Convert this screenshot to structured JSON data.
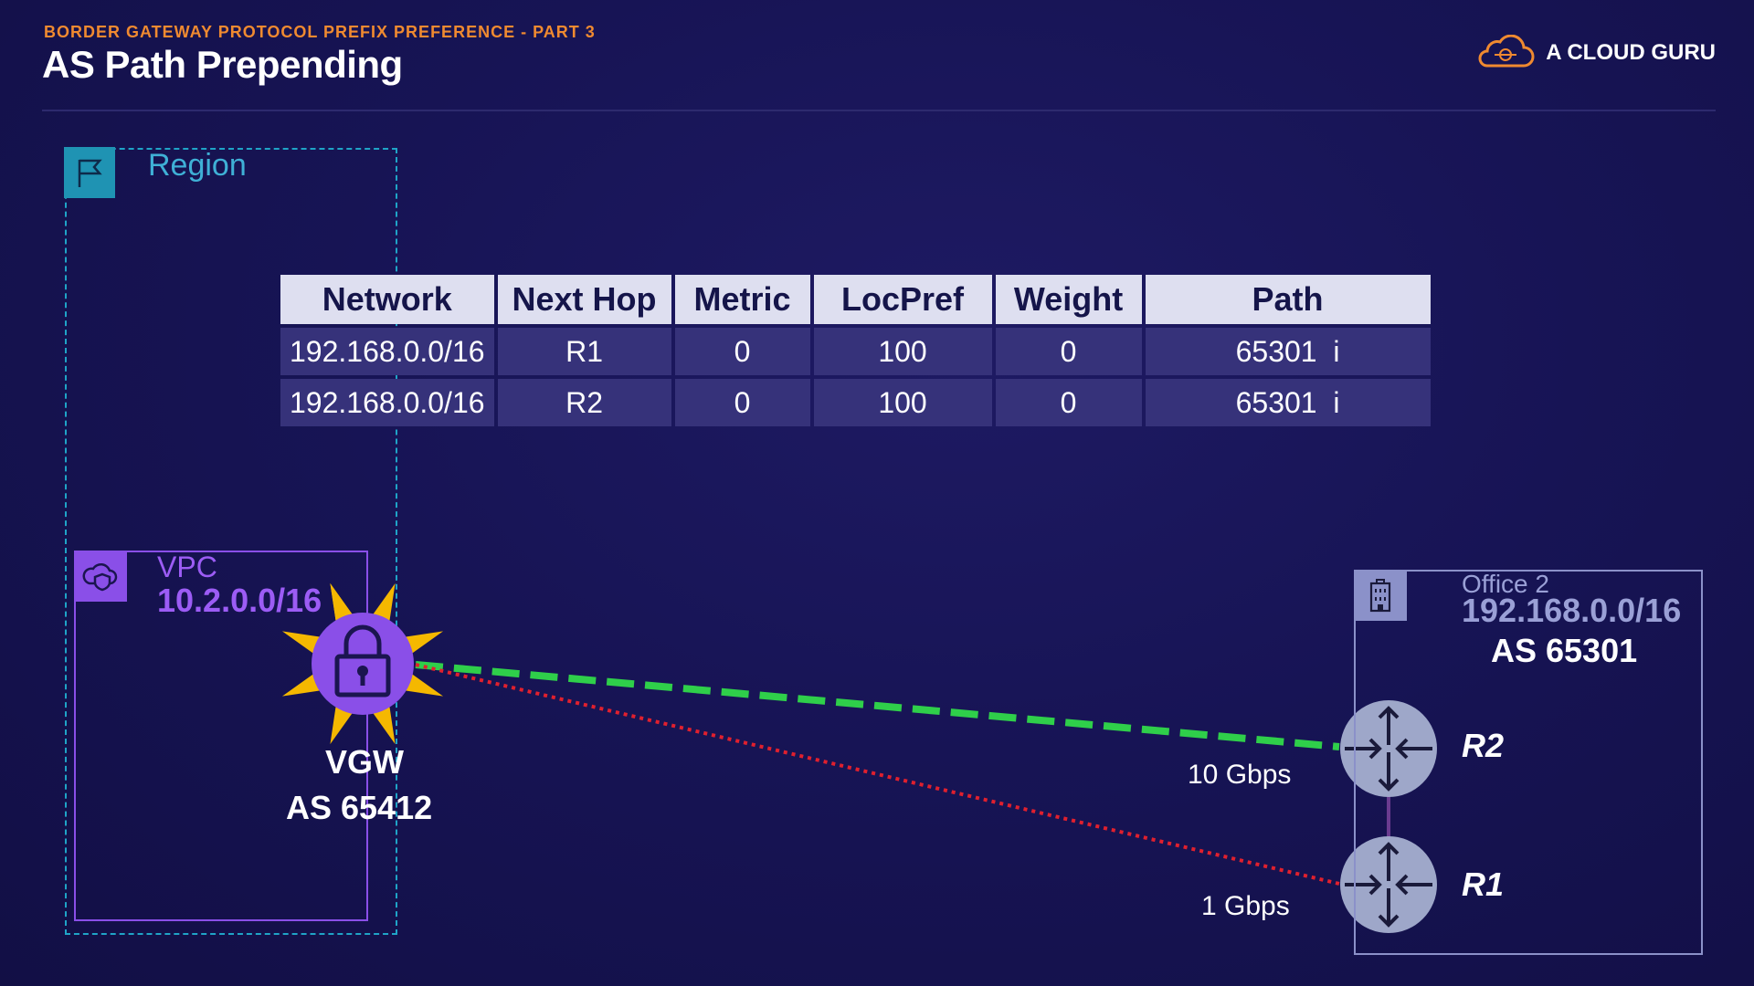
{
  "header": {
    "subtitle": "BORDER GATEWAY PROTOCOL PREFIX PREFERENCE - PART 3",
    "title": "AS Path Prepending",
    "brand": "A CLOUD GURU"
  },
  "region": {
    "label": "Region"
  },
  "vpc": {
    "label": "VPC",
    "cidr": "10.2.0.0/16"
  },
  "vgw": {
    "label": "VGW",
    "as": "AS 65412"
  },
  "office": {
    "label": "Office 2",
    "cidr": "192.168.0.0/16",
    "as": "AS 65301"
  },
  "routers": {
    "r2": "R2",
    "r1": "R1"
  },
  "links": {
    "r2_speed": "10 Gbps",
    "r1_speed": "1 Gbps"
  },
  "routing_table": {
    "columns": [
      "Network",
      "Next Hop",
      "Metric",
      "LocPref",
      "Weight",
      "Path"
    ],
    "rows": [
      [
        "192.168.0.0/16",
        "R1",
        "0",
        "100",
        "0",
        "65301  i"
      ],
      [
        "192.168.0.0/16",
        "R2",
        "0",
        "100",
        "0",
        "65301  i"
      ]
    ]
  },
  "colors": {
    "accent_orange": "#f08a30",
    "region_blue": "#1fa4c7",
    "vpc_purple": "#8a4fe8",
    "preferred_link": "#2fcf4a",
    "backup_link": "#e0202e",
    "vgw_burst": "#f5b800"
  },
  "icons": {
    "region": "flag-icon",
    "vpc": "cloud-shield-icon",
    "office": "building-icon",
    "vgw": "padlock-icon",
    "router": "router-arrows-icon",
    "brand": "cloud-logo-icon"
  }
}
